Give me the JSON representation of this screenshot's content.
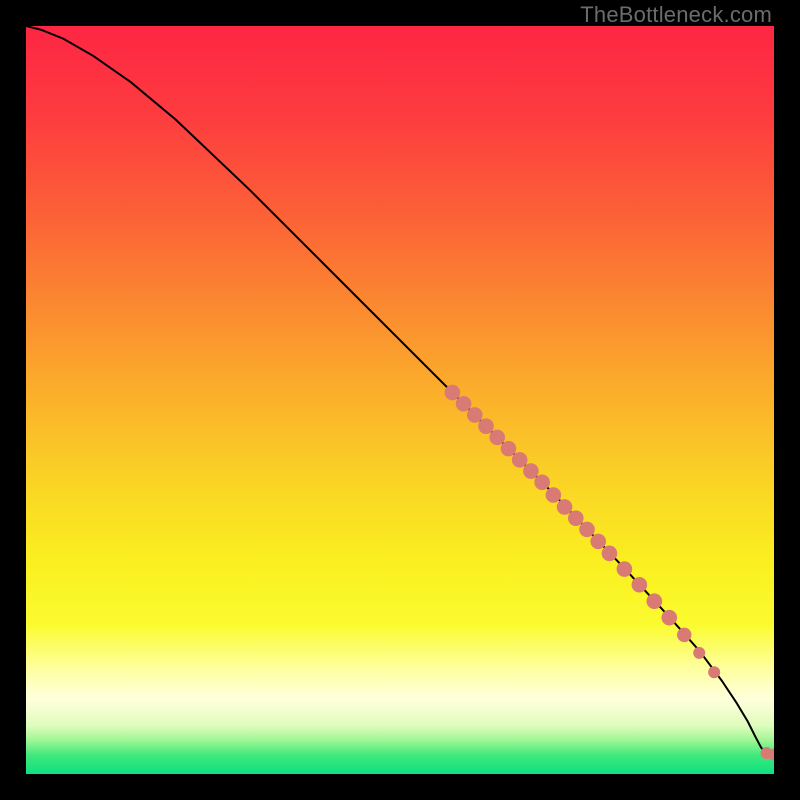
{
  "watermark": "TheBottleneck.com",
  "chart_data": {
    "type": "line",
    "title": "",
    "xlabel": "",
    "ylabel": "",
    "xlim": [
      0,
      100
    ],
    "ylim": [
      0,
      100
    ],
    "background_gradient": {
      "stops": [
        {
          "offset": 0.0,
          "color": "#fd2643"
        },
        {
          "offset": 0.12,
          "color": "#fd3c3f"
        },
        {
          "offset": 0.25,
          "color": "#fc6037"
        },
        {
          "offset": 0.38,
          "color": "#fb8b30"
        },
        {
          "offset": 0.5,
          "color": "#fbb22a"
        },
        {
          "offset": 0.62,
          "color": "#fad724"
        },
        {
          "offset": 0.72,
          "color": "#faf020"
        },
        {
          "offset": 0.8,
          "color": "#fbfb2f"
        },
        {
          "offset": 0.86,
          "color": "#feffa1"
        },
        {
          "offset": 0.9,
          "color": "#ffffdc"
        },
        {
          "offset": 0.935,
          "color": "#e0fcbd"
        },
        {
          "offset": 0.955,
          "color": "#9ef695"
        },
        {
          "offset": 0.975,
          "color": "#3fe97c"
        },
        {
          "offset": 1.0,
          "color": "#0fe081"
        }
      ]
    },
    "series": [
      {
        "name": "curve",
        "type": "line",
        "x": [
          0,
          2,
          5,
          9,
          14,
          20,
          30,
          40,
          50,
          60,
          70,
          80,
          86,
          90,
          93,
          95,
          96.5,
          97.5,
          98.3,
          99,
          100
        ],
        "y": [
          100,
          99.5,
          98.3,
          96,
          92.5,
          87.5,
          78,
          68,
          58,
          48,
          38,
          27.5,
          21,
          16.5,
          12.5,
          9.5,
          7,
          5,
          3.5,
          2.8,
          2.6
        ]
      },
      {
        "name": "dots",
        "type": "scatter",
        "color": "#d97a74",
        "points": [
          {
            "x": 57,
            "y": 51,
            "r": 1.3
          },
          {
            "x": 58.5,
            "y": 49.5,
            "r": 1.3
          },
          {
            "x": 60,
            "y": 48,
            "r": 1.3
          },
          {
            "x": 61.5,
            "y": 46.5,
            "r": 1.3
          },
          {
            "x": 63,
            "y": 45,
            "r": 1.3
          },
          {
            "x": 64.5,
            "y": 43.5,
            "r": 1.3
          },
          {
            "x": 66,
            "y": 42,
            "r": 1.3
          },
          {
            "x": 67.5,
            "y": 40.5,
            "r": 1.3
          },
          {
            "x": 69,
            "y": 39,
            "r": 1.3
          },
          {
            "x": 70.5,
            "y": 37.3,
            "r": 1.3
          },
          {
            "x": 72,
            "y": 35.7,
            "r": 1.3
          },
          {
            "x": 73.5,
            "y": 34.2,
            "r": 1.3
          },
          {
            "x": 75,
            "y": 32.7,
            "r": 1.3
          },
          {
            "x": 76.5,
            "y": 31.1,
            "r": 1.3
          },
          {
            "x": 78,
            "y": 29.5,
            "r": 1.3
          },
          {
            "x": 80,
            "y": 27.4,
            "r": 1.3
          },
          {
            "x": 82,
            "y": 25.3,
            "r": 1.3
          },
          {
            "x": 84,
            "y": 23.1,
            "r": 1.3
          },
          {
            "x": 86,
            "y": 20.9,
            "r": 1.3
          },
          {
            "x": 88,
            "y": 18.6,
            "r": 1.2
          },
          {
            "x": 90,
            "y": 16.2,
            "r": 1.0
          },
          {
            "x": 92,
            "y": 13.6,
            "r": 1.0
          },
          {
            "x": 99,
            "y": 2.8,
            "r": 1.0
          },
          {
            "x": 100,
            "y": 2.6,
            "r": 1.0
          }
        ]
      }
    ]
  }
}
